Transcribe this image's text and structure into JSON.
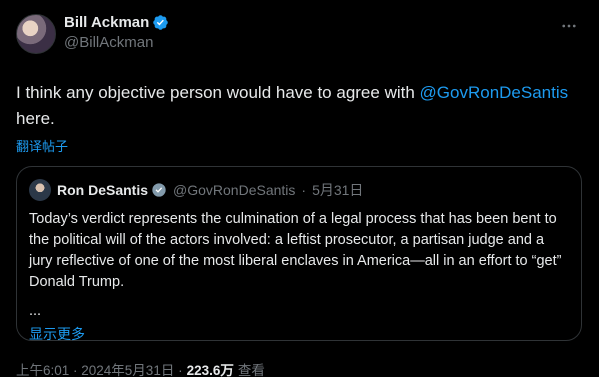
{
  "author": {
    "display_name": "Bill Ackman",
    "handle": "@BillAckman",
    "verified_color": "#1d9bf0"
  },
  "post": {
    "text_before": "I think any objective person would have to agree with ",
    "mention": "@GovRonDeSantis",
    "text_after": " here.",
    "translate_label": "翻译帖子"
  },
  "quoted": {
    "display_name": "Ron DeSantis",
    "handle": "@GovRonDeSantis",
    "separator": "·",
    "date": "5月31日",
    "text": "Today’s verdict represents the culmination of a legal process that has been bent to the political will of the actors involved: a leftist prosecutor, a partisan judge and a jury reflective of one of the most liberal enclaves in America—all in an effort to “get” Donald Trump.",
    "ellipsis": "...",
    "show_more_label": "显示更多"
  },
  "footer": {
    "timestamp": "上午6:01 · 2024年5月31日 ·",
    "views_count": "223.6万",
    "views_label": "查看"
  },
  "icons": {
    "more": "more-horizontal-icon",
    "verified": "verified-badge-icon"
  }
}
